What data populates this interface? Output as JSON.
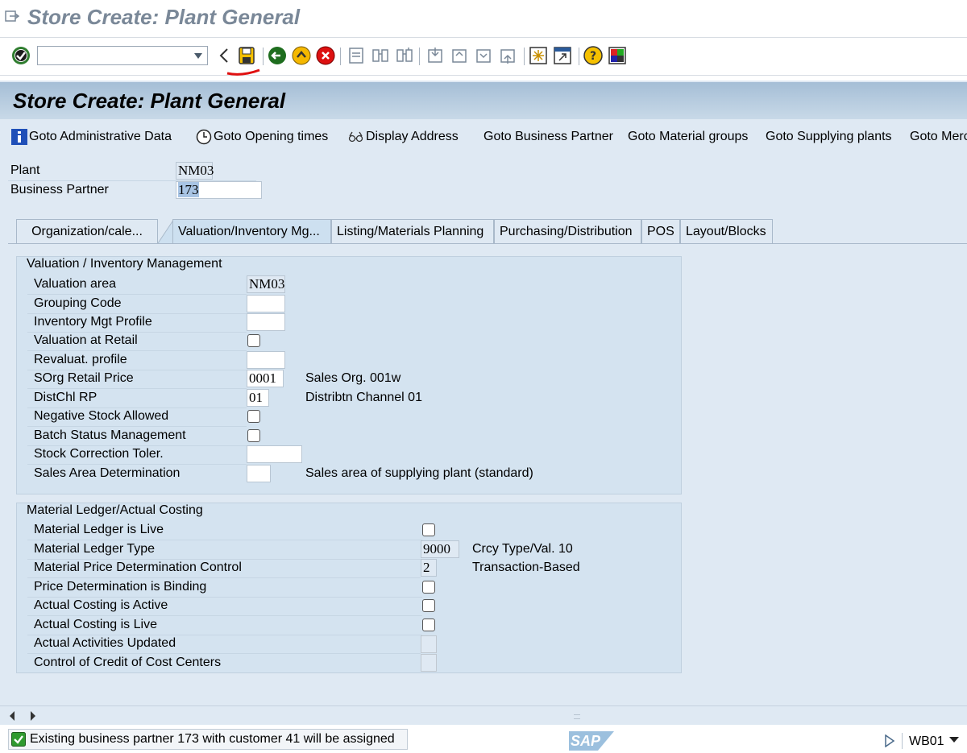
{
  "window": {
    "title": "Store Create: Plant General"
  },
  "toolbar": {
    "command_value": ""
  },
  "screen": {
    "title": "Store Create: Plant General"
  },
  "app_toolbar": [
    {
      "label": "Goto Administrative Data",
      "icon": "info-icon"
    },
    {
      "label": "Goto Opening times",
      "icon": "clock-icon"
    },
    {
      "label": "Display Address",
      "icon": "glasses-icon"
    },
    {
      "label": "Goto Business Partner",
      "icon": ""
    },
    {
      "label": "Goto Material groups",
      "icon": ""
    },
    {
      "label": "Goto Supplying plants",
      "icon": ""
    },
    {
      "label": "Goto Merc",
      "icon": ""
    }
  ],
  "header_fields": {
    "plant_label": "Plant",
    "plant_value": "NM03",
    "bp_label": "Business Partner",
    "bp_value": "173"
  },
  "tabs": [
    {
      "label": "Organization/cale..."
    },
    {
      "label": "Valuation/Inventory Mg...",
      "active": true
    },
    {
      "label": "Listing/Materials Planning"
    },
    {
      "label": "Purchasing/Distribution"
    },
    {
      "label": "POS"
    },
    {
      "label": "Layout/Blocks"
    }
  ],
  "valuation": {
    "title": "Valuation / Inventory Management",
    "valuation_area": {
      "label": "Valuation area",
      "value": "NM03"
    },
    "grouping_code": {
      "label": "Grouping Code",
      "value": ""
    },
    "inv_mgt_profile": {
      "label": "Inventory Mgt Profile",
      "value": ""
    },
    "valuation_retail": {
      "label": "Valuation at Retail",
      "checked": false
    },
    "revaluat_profile": {
      "label": "Revaluat. profile",
      "value": ""
    },
    "sorg_retail": {
      "label": "SOrg Retail Price",
      "value": "0001",
      "desc": "Sales Org. 001w"
    },
    "distchl_rp": {
      "label": "DistChl RP",
      "value": "01",
      "desc": "Distribtn Channel 01"
    },
    "neg_stock": {
      "label": "Negative Stock Allowed",
      "checked": false
    },
    "batch_status": {
      "label": "Batch Status Management",
      "checked": false
    },
    "stock_corr": {
      "label": "Stock Correction Toler.",
      "value": ""
    },
    "sales_area": {
      "label": "Sales Area Determination",
      "value": "",
      "desc": "Sales area of supplying plant (standard)"
    }
  },
  "ledger": {
    "title": "Material Ledger/Actual Costing",
    "ml_live": {
      "label": "Material Ledger is Live",
      "checked": false
    },
    "ml_type": {
      "label": "Material Ledger Type",
      "value": "9000",
      "desc": "Crcy Type/Val. 10"
    },
    "price_det": {
      "label": "Material Price Determination Control",
      "value": "2",
      "desc": "Transaction-Based"
    },
    "price_binding": {
      "label": "Price Determination is Binding",
      "checked": false
    },
    "ac_active": {
      "label": "Actual Costing is Active",
      "checked": false
    },
    "ac_live": {
      "label": "Actual Costing is Live",
      "checked": false
    },
    "act_updated": {
      "label": "Actual Activities Updated",
      "checked": false
    },
    "credit_cc": {
      "label": "Control of Credit of Cost Centers",
      "checked": false
    }
  },
  "status": {
    "message": "Existing business partner 173 with customer 41 will be assigned",
    "system": "WB01",
    "logo": "SAP"
  }
}
